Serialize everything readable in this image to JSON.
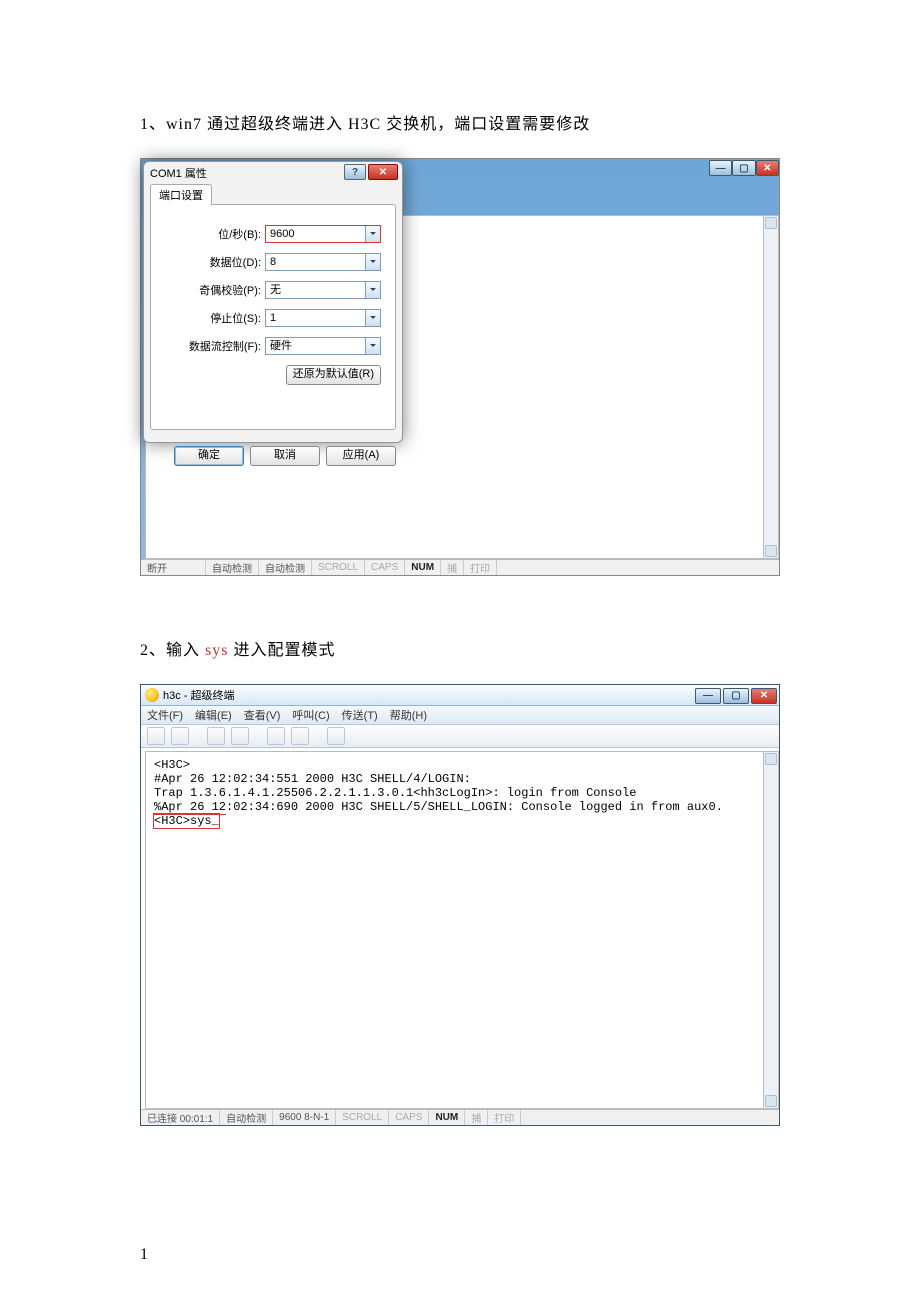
{
  "doc": {
    "step1_prefix": "1、win7 通过超级终端进入 H3C 交换机，端口设置需要修改",
    "step2_prefix": "2、输入 ",
    "step2_red": "sys",
    "step2_suffix": " 进入配置模式",
    "page_number": "1"
  },
  "dlg": {
    "title": "COM1 属性",
    "help": "?",
    "close": "✕",
    "tab": "端口设置",
    "rows": {
      "baud_label": "位/秒(B):",
      "baud_val": "9600",
      "data_label": "数据位(D):",
      "data_val": "8",
      "parity_label": "奇偶校验(P):",
      "parity_val": "无",
      "stop_label": "停止位(S):",
      "stop_val": "1",
      "flow_label": "数据流控制(F):",
      "flow_val": "硬件"
    },
    "restore": "还原为默认值(R)",
    "ok": "确定",
    "cancel": "取消",
    "apply": "应用(A)"
  },
  "status1": {
    "s1": "断开",
    "s2": "自动检测",
    "s3": "自动检测",
    "s4": "SCROLL",
    "s5": "CAPS",
    "s6": "NUM",
    "s7": "捕",
    "s8": "打印"
  },
  "term2": {
    "title": "h3c - 超级终端",
    "menu": {
      "file": "文件(F)",
      "edit": "编辑(E)",
      "view": "查看(V)",
      "call": "呼叫(C)",
      "transfer": "传送(T)",
      "help": "帮助(H)"
    },
    "console": {
      "l0": "",
      "l1": "<H3C>",
      "l2": "#Apr 26 12:02:34:551 2000 H3C SHELL/4/LOGIN:",
      "l3": " Trap 1.3.6.1.4.1.25506.2.2.1.1.3.0.1<hh3cLogIn>: login from Console",
      "l4a": "%Apr 26 12",
      "l4b": ":02:34:690 2000 H3C SHELL/5/SHELL_LOGIN: Console logged in from aux0.",
      "l5": "<H3C>sys_"
    },
    "status": {
      "s1": "已连接 00:01:1",
      "s2": "自动检测",
      "s3": "9600 8-N-1",
      "s4": "SCROLL",
      "s5": "CAPS",
      "s6": "NUM",
      "s7": "捕",
      "s8": "打印"
    }
  }
}
